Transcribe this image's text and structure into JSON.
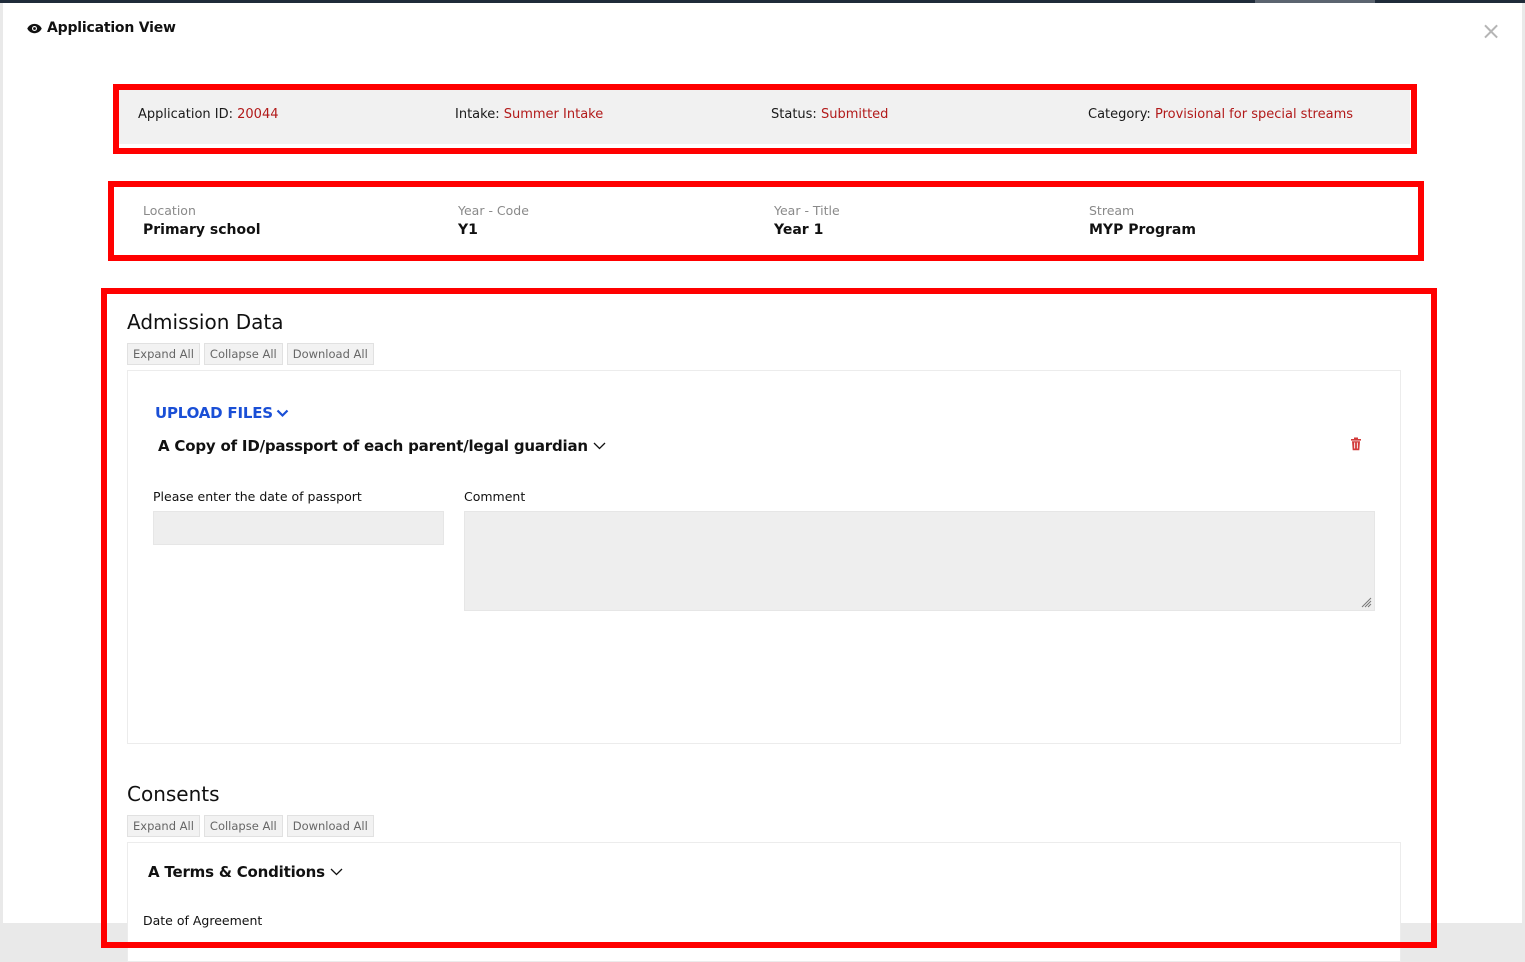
{
  "window": {
    "title": "Application View",
    "close_symbol": "×"
  },
  "summary": {
    "application_id_label": "Application ID:",
    "application_id_value": "20044",
    "intake_label": "Intake:",
    "intake_value": "Summer Intake",
    "status_label": "Status:",
    "status_value": "Submitted",
    "category_label": "Category:",
    "category_value": "Provisional for special streams"
  },
  "program": {
    "location_label": "Location",
    "location_value": "Primary school",
    "year_code_label": "Year - Code",
    "year_code_value": "Y1",
    "year_title_label": "Year - Title",
    "year_title_value": "Year 1",
    "stream_label": "Stream",
    "stream_value": "MYP Program"
  },
  "admission": {
    "title": "Admission Data",
    "buttons": {
      "expand": "Expand All",
      "collapse": "Collapse All",
      "download": "Download All"
    },
    "upload_label": "UPLOAD FILES",
    "document_title": "A Copy of ID/passport of each parent/legal guardian",
    "date_label": "Please enter the date of passport",
    "date_value": "",
    "comment_label": "Comment",
    "comment_value": ""
  },
  "consents": {
    "title": "Consents",
    "buttons": {
      "expand": "Expand All",
      "collapse": "Collapse All",
      "download": "Download All"
    },
    "document_title": "A Terms & Conditions",
    "date_label": "Date of Agreement"
  },
  "colors": {
    "highlight": "#ff0000",
    "value_red": "#b21a1a",
    "link_blue": "#1a4fd6"
  },
  "icons": [
    "eye-icon",
    "close-icon",
    "chevron-down-icon",
    "trash-icon",
    "resize-grip-icon"
  ]
}
